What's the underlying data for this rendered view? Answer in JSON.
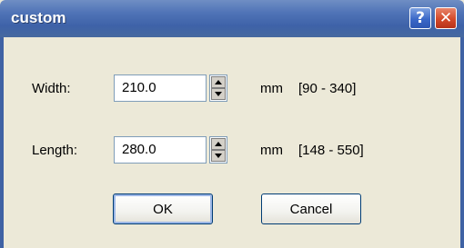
{
  "window": {
    "title": "custom",
    "help_label": "?",
    "close_label": "✕"
  },
  "width": {
    "label": "Width:",
    "value": "210.0",
    "unit": "mm",
    "range": "[90 - 340]"
  },
  "length": {
    "label": "Length:",
    "value": "280.0",
    "unit": "mm",
    "range": "[148 - 550]"
  },
  "buttons": {
    "ok_label": "OK",
    "cancel_label": "Cancel"
  },
  "colors": {
    "titlebar": "#4f73b6",
    "body": "#ece9d8",
    "close": "#d4492a"
  }
}
